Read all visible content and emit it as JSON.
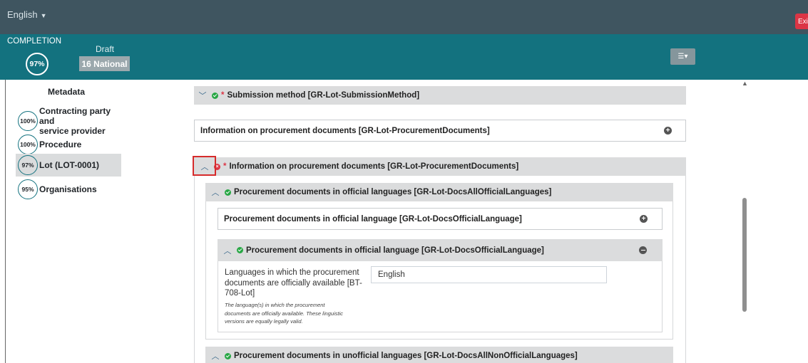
{
  "topbar": {
    "language": "English",
    "exit_label": "Exit"
  },
  "completion": {
    "label": "COMPLETION",
    "percent": "97%",
    "status": "Draft",
    "notice_type": "16 National"
  },
  "sidebar": {
    "metadata_label": "Metadata",
    "items": [
      {
        "percent": "100%",
        "label_line1": "Contracting party and",
        "label_line2": "service provider"
      },
      {
        "percent": "100%",
        "label": "Procedure"
      },
      {
        "percent": "97%",
        "label": "Lot (LOT-0001)",
        "active": true
      },
      {
        "percent": "95%",
        "label": "Organisations"
      }
    ]
  },
  "main": {
    "submission_method": "Submission method  [GR-Lot-SubmissionMethod]",
    "info_docs_collapsed": "Information on procurement documents  [GR-Lot-ProcurementDocuments]",
    "info_docs_expanded": "Information on procurement documents  [GR-Lot-ProcurementDocuments]",
    "docs_official": "Procurement documents in official languages  [GR-Lot-DocsAllOfficialLanguages]",
    "doc_official_collapsed": "Procurement documents in official language  [GR-Lot-DocsOfficialLanguage]",
    "doc_official_expanded": "Procurement documents in official language  [GR-Lot-DocsOfficialLanguage]",
    "field": {
      "label_lines": [
        "Languages in which the procurement",
        "documents are officially available [BT-",
        "708-Lot]"
      ],
      "help_lines": [
        "The language(s) in which the procurement",
        "documents are officially available. These linguistic",
        "versions are equally legally valid."
      ],
      "value": "English"
    },
    "docs_unofficial": "Procurement documents in unofficial languages  [GR-Lot-DocsAllNonOfficialLanguages]"
  }
}
